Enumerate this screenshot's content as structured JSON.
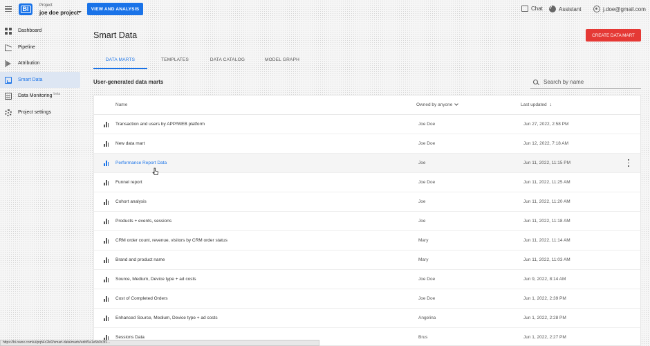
{
  "header": {
    "project_label": "Project",
    "project_name": "joe doe project",
    "view_button": "VIEW AND ANALYSIS",
    "chat_label": "Chat",
    "assistant_label": "Assistant",
    "user_email": "j.doe@gmail.com",
    "logo_text": "BI"
  },
  "sidebar": {
    "items": [
      {
        "label": "Dashboard",
        "icon": "dashboard-icon"
      },
      {
        "label": "Pipeline",
        "icon": "pipeline-icon"
      },
      {
        "label": "Attribution",
        "icon": "attribution-icon"
      },
      {
        "label": "Smart Data",
        "icon": "smart-data-icon",
        "active": true
      },
      {
        "label": "Data Monitoring",
        "badge": "beta",
        "icon": "data-monitoring-icon"
      },
      {
        "label": "Project settings",
        "icon": "gear-icon"
      }
    ]
  },
  "main": {
    "title": "Smart Data",
    "create_button": "CREATE DATA MART",
    "tabs": [
      {
        "label": "DATA MARTS",
        "active": true
      },
      {
        "label": "TEMPLATES"
      },
      {
        "label": "DATA CATALOG"
      },
      {
        "label": "MODEL GRAPH"
      }
    ],
    "section_title": "User-generated data marts",
    "search_placeholder": "Search by name",
    "table": {
      "col_name": "Name",
      "col_owner": "Owned by anyone",
      "col_updated": "Last updated",
      "rows": [
        {
          "name": "Transaction and users by APP/WEB platform",
          "owner": "Joe Doe",
          "updated": "Jun 27, 2022, 2:58 PM"
        },
        {
          "name": "New data mart",
          "owner": "Joe Doe",
          "updated": "Jun 12, 2022, 7:18 AM"
        },
        {
          "name": "Performance Report Data",
          "owner": "Joe",
          "updated": "Jun 11, 2022, 11:15 PM",
          "hover": true
        },
        {
          "name": "Funnel report",
          "owner": "Joe Doe",
          "updated": "Jun 11, 2022, 11:25 AM"
        },
        {
          "name": "Cohort analysis",
          "owner": "Joe",
          "updated": "Jun 11, 2022, 11:20 AM"
        },
        {
          "name": "Products + events, sessions",
          "owner": "Joe",
          "updated": "Jun 11, 2022, 11:18 AM"
        },
        {
          "name": "CRM order count, revenue, visitors by CRM order status",
          "owner": "Mary",
          "updated": "Jun 11, 2022, 11:14 AM"
        },
        {
          "name": "Brand and product name",
          "owner": "Mary",
          "updated": "Jun 11, 2022, 11:03 AM"
        },
        {
          "name": "Source, Medium, Device type + ad costs",
          "owner": "Joe Doe",
          "updated": "Jun 9, 2022, 8:14 AM"
        },
        {
          "name": "Cost of Completed Orders",
          "owner": "Joe Doe",
          "updated": "Jun 1, 2022, 2:39 PM"
        },
        {
          "name": "Enhanced Source, Medium, Device type + ad costs",
          "owner": "Angelina",
          "updated": "Jun 1, 2022, 2:28 PM"
        },
        {
          "name": "Sessions Data",
          "owner": "Brus",
          "updated": "Jun 1, 2022, 2:27 PM"
        }
      ]
    }
  },
  "status_bar_url": "https://bi.owox.com/ui/pqh4c2ki0/smart-data/marts/edit/5a1e5b0c3f2..."
}
